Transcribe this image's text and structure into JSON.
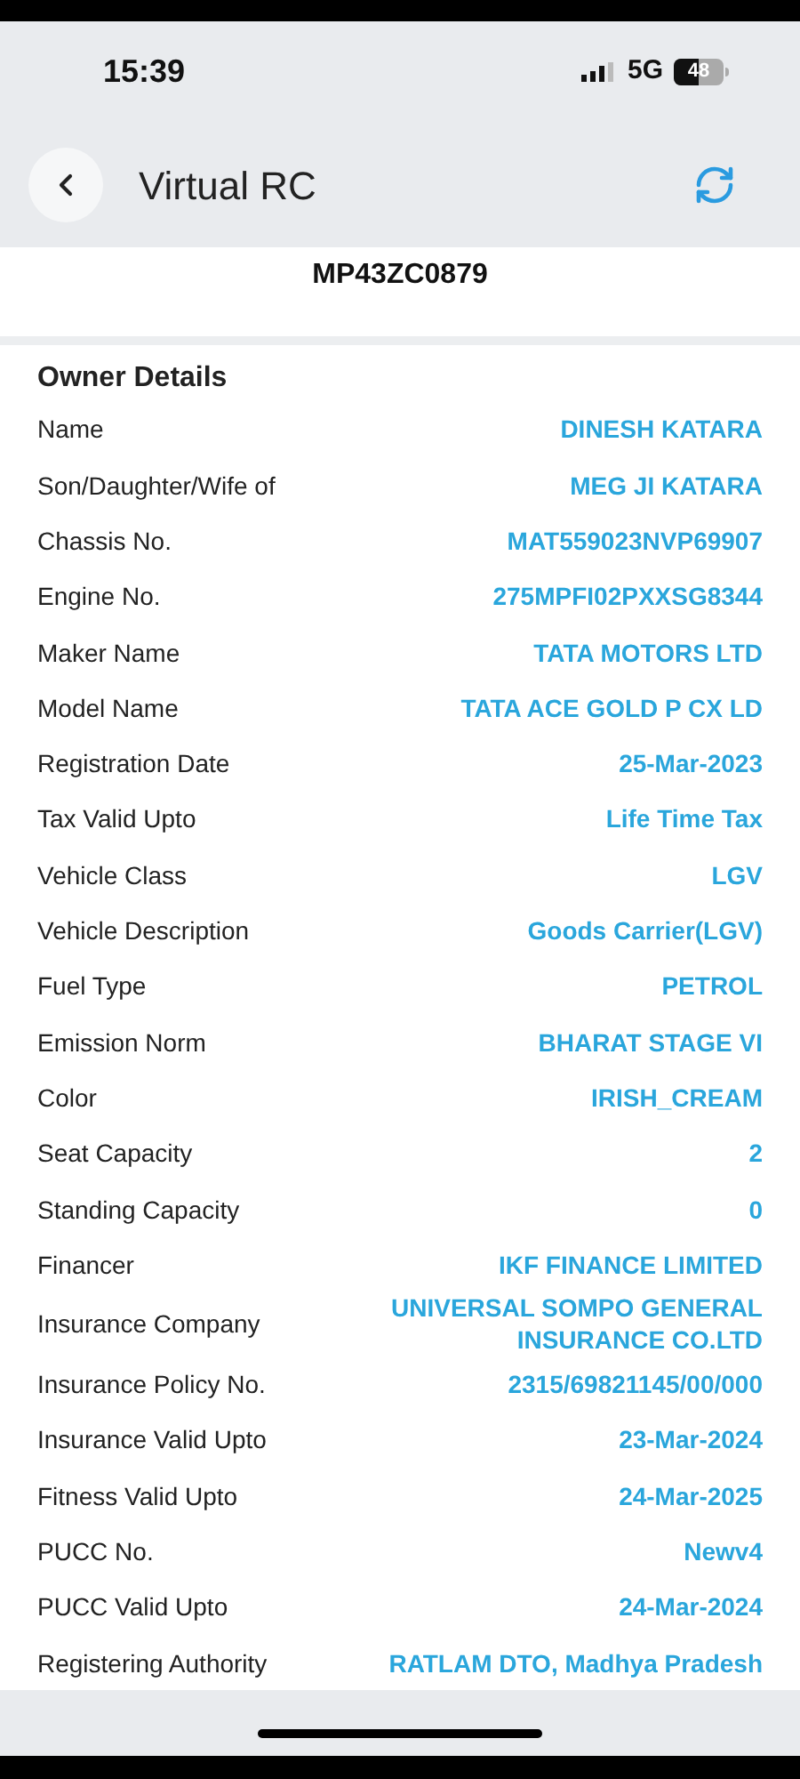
{
  "status_bar": {
    "time": "15:39",
    "network": "5G",
    "battery": "48"
  },
  "header": {
    "title": "Virtual RC"
  },
  "registration_number": "MP43ZC0879",
  "section": {
    "title": "Owner Details",
    "rows": [
      {
        "label": "Name",
        "value": "DINESH KATARA"
      },
      {
        "label": "Son/Daughter/Wife of",
        "value": "MEG JI KATARA"
      },
      {
        "label": "Chassis No.",
        "value": "MAT559023NVP69907"
      },
      {
        "label": "Engine No.",
        "value": "275MPFI02PXXSG8344"
      },
      {
        "label": "Maker Name",
        "value": "TATA MOTORS LTD"
      },
      {
        "label": "Model Name",
        "value": "TATA ACE GOLD P CX LD"
      },
      {
        "label": "Registration Date",
        "value": "25-Mar-2023"
      },
      {
        "label": "Tax Valid Upto",
        "value": "Life Time Tax"
      },
      {
        "label": "Vehicle Class",
        "value": "LGV"
      },
      {
        "label": "Vehicle Description",
        "value": "Goods Carrier(LGV)"
      },
      {
        "label": "Fuel Type",
        "value": "PETROL"
      },
      {
        "label": "Emission Norm",
        "value": "BHARAT STAGE VI"
      },
      {
        "label": "Color",
        "value": "IRISH_CREAM"
      },
      {
        "label": "Seat Capacity",
        "value": "2"
      },
      {
        "label": "Standing Capacity",
        "value": "0"
      },
      {
        "label": "Financer",
        "value": "IKF FINANCE LIMITED"
      },
      {
        "label": "Insurance Company",
        "value": "UNIVERSAL SOMPO GENERAL INSURANCE CO.LTD"
      },
      {
        "label": "Insurance Policy No.",
        "value": "2315/69821145/00/000"
      },
      {
        "label": "Insurance Valid Upto",
        "value": "23-Mar-2024"
      },
      {
        "label": "Fitness Valid Upto",
        "value": "24-Mar-2025"
      },
      {
        "label": "PUCC No.",
        "value": "Newv4"
      },
      {
        "label": "PUCC Valid Upto",
        "value": "24-Mar-2024"
      },
      {
        "label": "Registering Authority",
        "value": "RATLAM DTO, Madhya Pradesh"
      }
    ]
  }
}
